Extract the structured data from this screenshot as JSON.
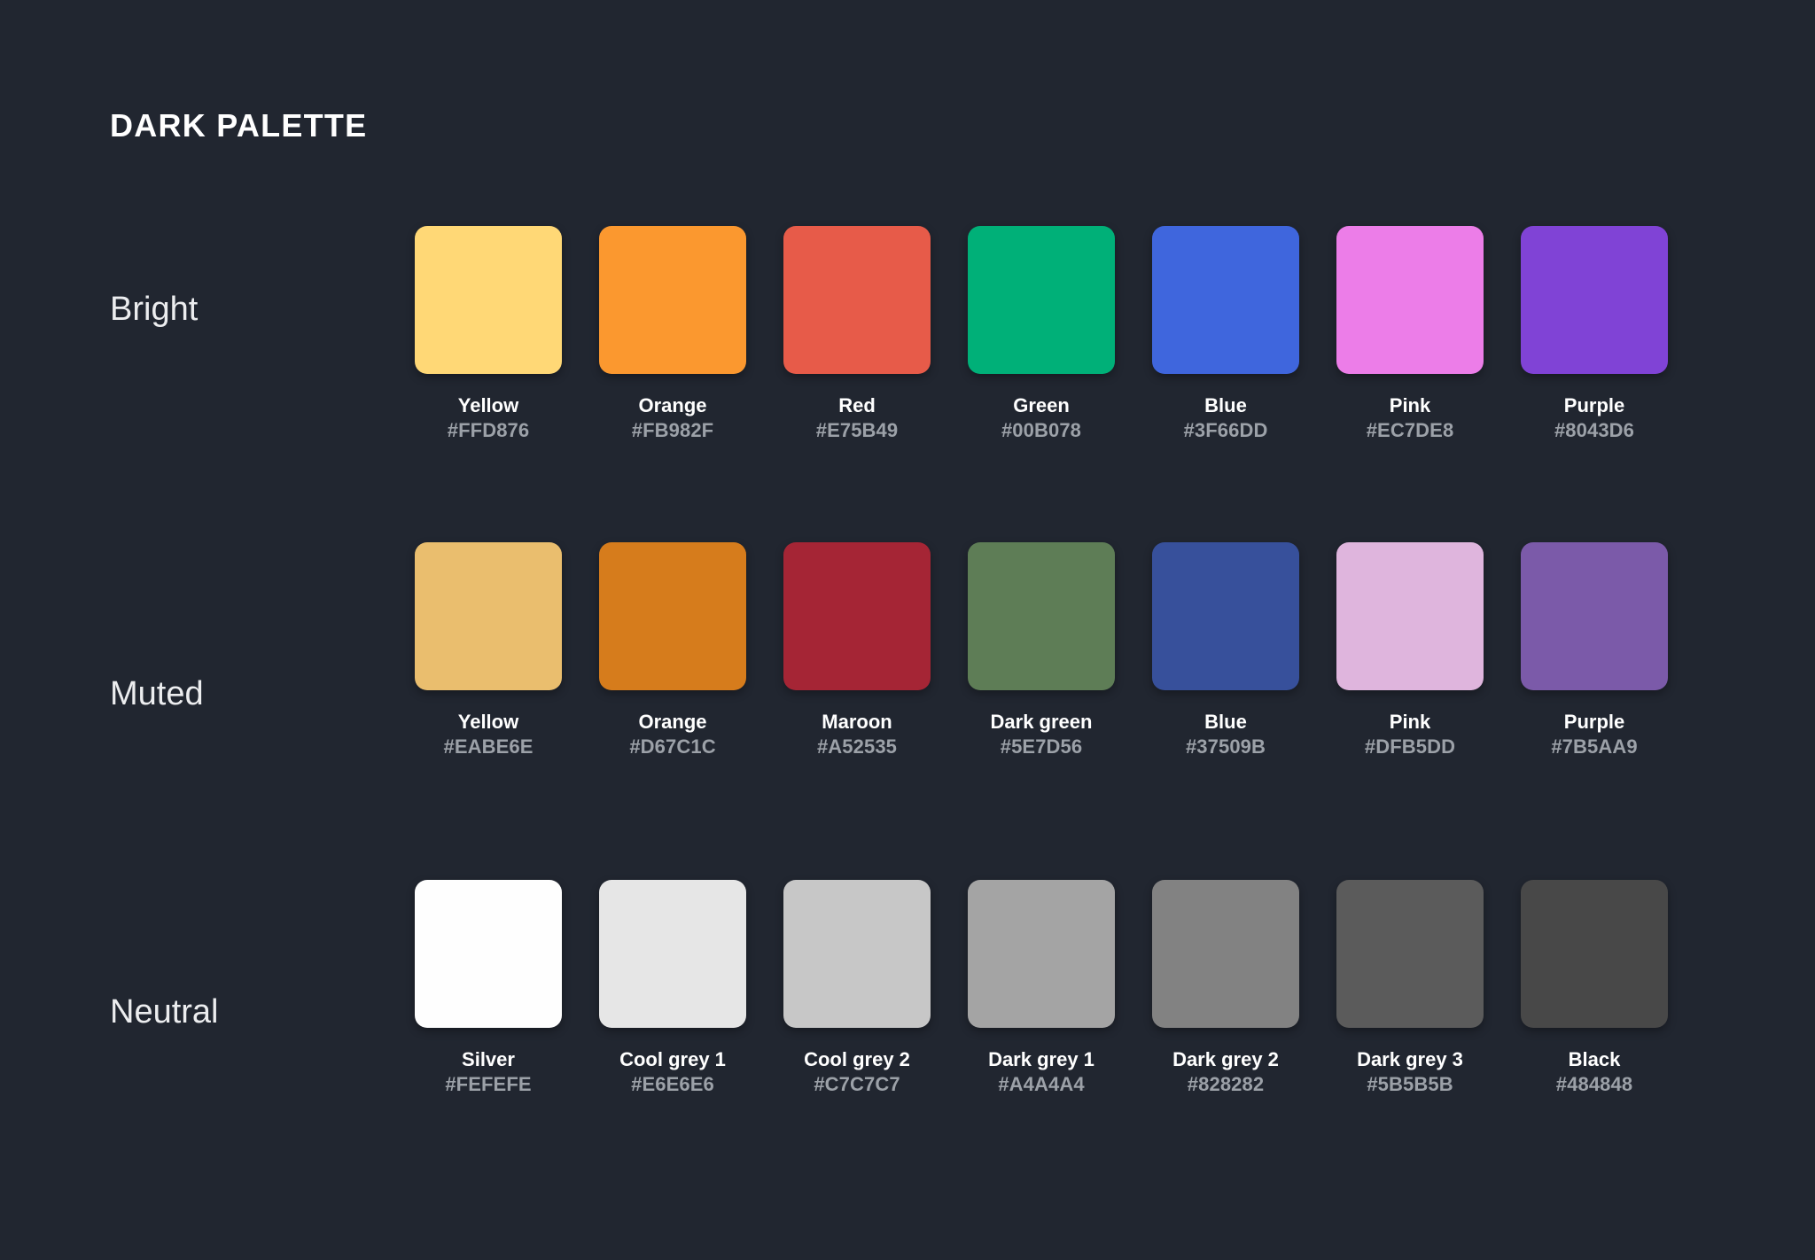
{
  "title": "DARK PALETTE",
  "background_color": "#212630",
  "title_color": "#FFFFFF",
  "name_color": "#FFFFFF",
  "hex_label_color": "#9CA1A8",
  "rows": [
    {
      "label": "Bright",
      "swatches": [
        {
          "name": "Yellow",
          "hex": "#FFD876"
        },
        {
          "name": "Orange",
          "hex": "#FB982F"
        },
        {
          "name": "Red",
          "hex": "#E75B49"
        },
        {
          "name": "Green",
          "hex": "#00B078"
        },
        {
          "name": "Blue",
          "hex": "#3F66DD"
        },
        {
          "name": "Pink",
          "hex": "#EC7DE8"
        },
        {
          "name": "Purple",
          "hex": "#8043D6"
        }
      ]
    },
    {
      "label": "Muted",
      "swatches": [
        {
          "name": "Yellow",
          "hex": "#EABE6E"
        },
        {
          "name": "Orange",
          "hex": "#D67C1C"
        },
        {
          "name": "Maroon",
          "hex": "#A52535"
        },
        {
          "name": "Dark green",
          "hex": "#5E7D56"
        },
        {
          "name": "Blue",
          "hex": "#37509B"
        },
        {
          "name": "Pink",
          "hex": "#DFB5DD"
        },
        {
          "name": "Purple",
          "hex": "#7B5AA9"
        }
      ]
    },
    {
      "label": "Neutral",
      "swatches": [
        {
          "name": "Silver",
          "hex": "#FEFEFE"
        },
        {
          "name": "Cool grey 1",
          "hex": "#E6E6E6"
        },
        {
          "name": "Cool grey 2",
          "hex": "#C7C7C7"
        },
        {
          "name": "Dark grey 1",
          "hex": "#A4A4A4"
        },
        {
          "name": "Dark grey 2",
          "hex": "#828282"
        },
        {
          "name": "Dark grey 3",
          "hex": "#5B5B5B"
        },
        {
          "name": "Black",
          "hex": "#484848"
        }
      ]
    }
  ]
}
